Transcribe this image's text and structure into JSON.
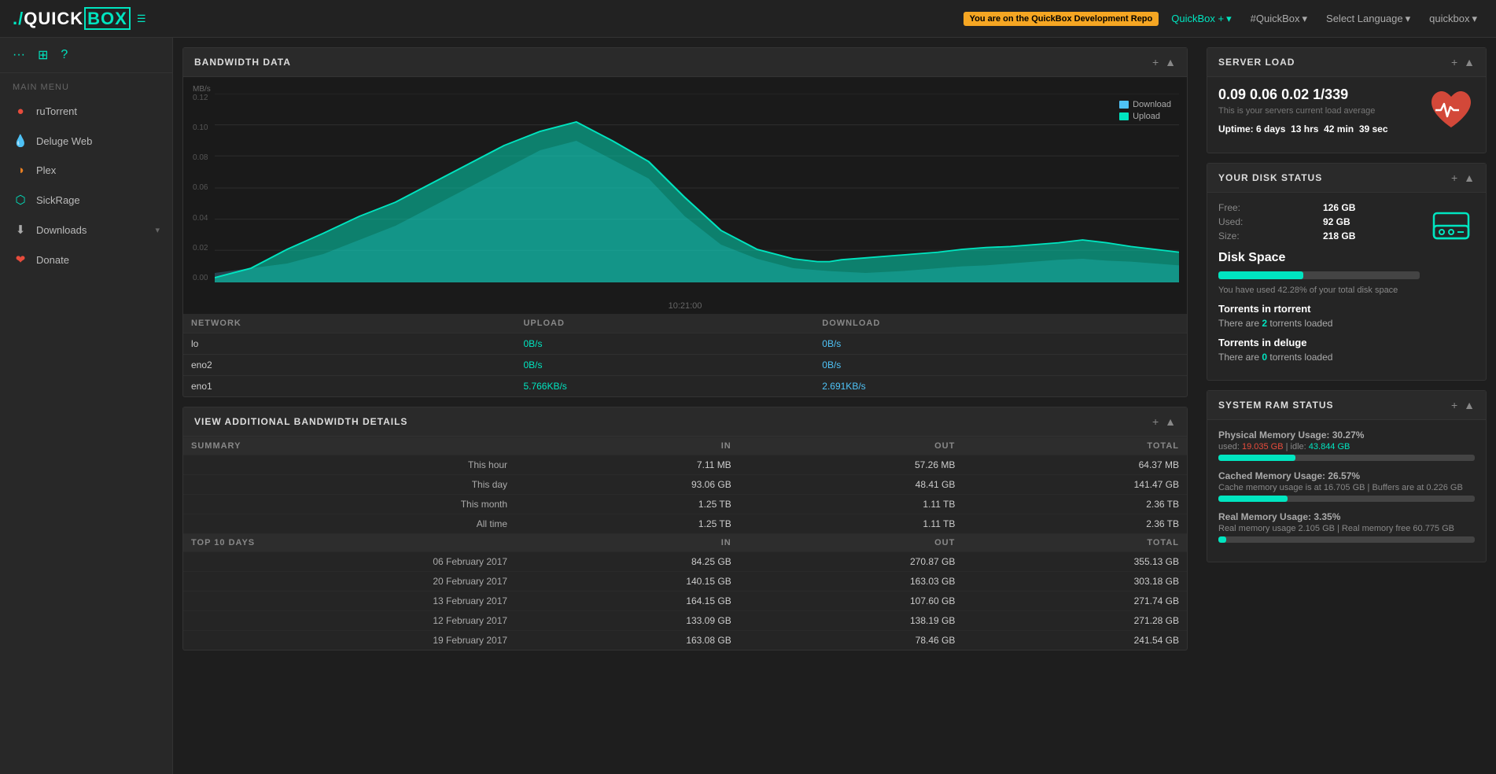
{
  "topnav": {
    "logo": {
      "prefix": "./",
      "quick": "QUICK",
      "box": "BOX"
    },
    "dev_badge": "You are on the QuickBox Development Repo",
    "menu_icon": "☰",
    "quickbox_btn": "QuickBox +",
    "hashquickbox_btn": "#QuickBox",
    "language_btn": "Select Language",
    "user_btn": "quickbox",
    "dropdown_arrow": "▾"
  },
  "sidebar": {
    "menu_label": "MAIN MENU",
    "icon_ellipsis": "···",
    "icon_puzzle": "⊞",
    "icon_question": "?",
    "items": [
      {
        "id": "rutorrent",
        "label": "ruTorrent",
        "icon": "🔴",
        "icon_type": "circle-red"
      },
      {
        "id": "deluge",
        "label": "Deluge Web",
        "icon": "💧",
        "icon_type": "circle-blue"
      },
      {
        "id": "plex",
        "label": "Plex",
        "icon": "🟠",
        "icon_type": "circle-orange"
      },
      {
        "id": "sickrage",
        "label": "SickRage",
        "icon": "🦠",
        "icon_type": "circle-green"
      },
      {
        "id": "downloads",
        "label": "Downloads",
        "icon": "⬇",
        "icon_type": "download",
        "has_arrow": true
      },
      {
        "id": "donate",
        "label": "Donate",
        "icon": "❤",
        "icon_type": "heart"
      }
    ]
  },
  "bandwidth_card": {
    "title": "BANDWIDTH DATA",
    "y_labels": [
      "0.12",
      "0.10",
      "0.08",
      "0.06",
      "0.04",
      "0.02",
      "0.00"
    ],
    "y_unit": "MB/s",
    "time_label": "10:21:00",
    "legend_download": "Download",
    "legend_upload": "Upload",
    "network_table": {
      "cols": [
        "NETWORK",
        "UPLOAD",
        "DOWNLOAD"
      ],
      "rows": [
        {
          "name": "lo",
          "upload": "0B/s",
          "download": "0B/s"
        },
        {
          "name": "eno2",
          "upload": "0B/s",
          "download": "0B/s"
        },
        {
          "name": "eno1",
          "upload": "5.766KB/s",
          "download": "2.691KB/s"
        }
      ]
    }
  },
  "bw_details_card": {
    "title": "VIEW ADDITIONAL BANDWIDTH DETAILS",
    "summary_cols": [
      "SUMMARY",
      "IN",
      "OUT",
      "TOTAL"
    ],
    "summary_rows": [
      {
        "label": "This hour",
        "in": "7.11 MB",
        "out": "57.26 MB",
        "total": "64.37 MB"
      },
      {
        "label": "This day",
        "in": "93.06 GB",
        "out": "48.41 GB",
        "total": "141.47 GB"
      },
      {
        "label": "This month",
        "in": "1.25 TB",
        "out": "1.11 TB",
        "total": "2.36 TB"
      },
      {
        "label": "All time",
        "in": "1.25 TB",
        "out": "1.11 TB",
        "total": "2.36 TB"
      }
    ],
    "top10_cols": [
      "TOP 10 DAYS",
      "IN",
      "OUT",
      "TOTAL"
    ],
    "top10_rows": [
      {
        "label": "06 February 2017",
        "in": "84.25 GB",
        "out": "270.87 GB",
        "total": "355.13 GB"
      },
      {
        "label": "20 February 2017",
        "in": "140.15 GB",
        "out": "163.03 GB",
        "total": "303.18 GB"
      },
      {
        "label": "13 February 2017",
        "in": "164.15 GB",
        "out": "107.60 GB",
        "total": "271.74 GB"
      },
      {
        "label": "12 February 2017",
        "in": "133.09 GB",
        "out": "138.19 GB",
        "total": "271.28 GB"
      },
      {
        "label": "19 February 2017",
        "in": "163.08 GB",
        "out": "78.46 GB",
        "total": "241.54 GB"
      }
    ]
  },
  "server_load_card": {
    "title": "SERVER LOAD",
    "load_value": "0.09 0.06 0.02 1/339",
    "load_sub": "This is your servers current load average",
    "uptime_label": "Uptime:",
    "uptime_days": "6",
    "uptime_hrs": "13",
    "uptime_min": "42",
    "uptime_sec": "39",
    "uptime_text": "days  hrs  min  sec"
  },
  "disk_status_card": {
    "title": "YOUR DISK STATUS",
    "free_label": "Free:",
    "free_value": "126 GB",
    "used_label": "Used:",
    "used_value": "92 GB",
    "size_label": "Size:",
    "size_value": "218 GB",
    "disk_space_title": "Disk Space",
    "bar_pct": 42,
    "usage_text": "You have used 42.28% of your total disk space"
  },
  "torrents_card": {
    "rtorrent_title": "Torrents in rtorrent",
    "rtorrent_text_pre": "There are ",
    "rtorrent_count": "2",
    "rtorrent_text_post": " torrents loaded",
    "deluge_title": "Torrents in deluge",
    "deluge_text_pre": "There are ",
    "deluge_count": "0",
    "deluge_text_post": " torrents loaded"
  },
  "ram_card": {
    "title": "SYSTEM RAM STATUS",
    "physical_title": "Physical Memory Usage: 30.27%",
    "physical_pct": 30,
    "physical_used": "19.035 GB",
    "physical_idle": "43.844 GB",
    "cached_title": "Cached Memory Usage: 26.57%",
    "cached_pct": 27,
    "cached_text": "Cache memory usage is at 16.705 GB | Buffers are at 0.226 GB",
    "real_title": "Real Memory Usage: 3.35%",
    "real_pct": 3,
    "real_text": "Real memory usage 2.105 GB | Real memory free 60.775 GB"
  }
}
